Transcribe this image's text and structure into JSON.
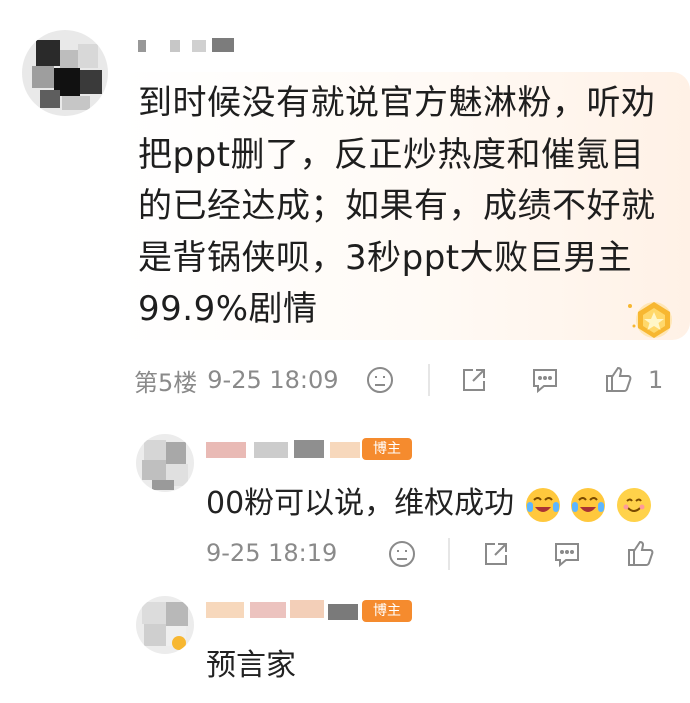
{
  "comment": {
    "username": "",
    "body": "到时候没有就说官方魅淋粉，听劝把ppt删了，反正炒热度和催氪目的已经达成；如果有，成绩不好就是背锅侠呗，3秒ppt大败巨男主99.9%剧情",
    "floor": "第5楼",
    "time": "9-25 18:09",
    "like_count": "1"
  },
  "replies": [
    {
      "badge": "博主",
      "text": "00粉可以说，维权成功",
      "emojis": [
        "crying-laugh-emoji",
        "crying-laugh-emoji",
        "smile-emoji"
      ],
      "time": "9-25 18:19"
    },
    {
      "badge": "博主",
      "text": "预言家"
    }
  ],
  "colors": {
    "accent_orange": "#f58b2e",
    "meta_gray": "#8a8a8a",
    "text": "#1e1e1e"
  }
}
